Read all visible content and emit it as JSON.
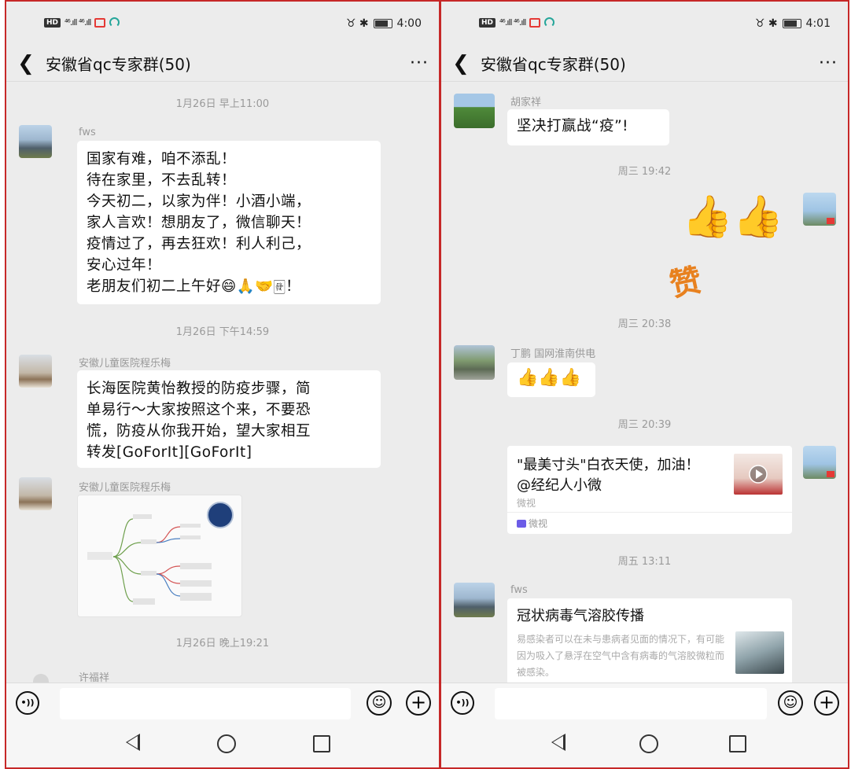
{
  "left": {
    "status": {
      "hd": "HD",
      "signal": "⁴⁶.ıll ⁴⁶.ıll",
      "right_icons": "♉ ✱",
      "time": "4:00"
    },
    "title": "安徽省qc专家群(50)",
    "timestamps": [
      "1月26日 早上11:00",
      "1月26日 下午14:59",
      "1月26日 晚上19:21"
    ],
    "messages": [
      {
        "sender": "fws",
        "lines": [
          "国家有难，咱不添乱！",
          "待在家里，不去乱转！",
          "今天初二，以家为伴！小酒小端，",
          "家人言欢！想朋友了，微信聊天！",
          "疫情过了，再去狂欢！利人利己，",
          "安心过年！",
          "老朋友们初二上午好😄🙏🤝🀅！"
        ]
      },
      {
        "sender": "安徽儿童医院程乐梅",
        "lines": [
          "长海医院黄怡教授的防疫步骤，简",
          "单易行～大家按照这个来，不要恐",
          "慌，防疫从你我开始，望大家相互",
          "转发[GoForIt][GoForIt]"
        ]
      },
      {
        "sender": "安徽儿童医院程乐梅",
        "image": "mindmap"
      },
      {
        "sender": "许福祥"
      }
    ]
  },
  "right": {
    "status": {
      "hd": "HD",
      "signal": "⁴⁶.ıll ⁴⁶.ıll",
      "right_icons": "♉ ✱",
      "time": "4:01"
    },
    "title": "安徽省qc专家群(50)",
    "messages": [
      {
        "sender": "胡家祥",
        "text": "坚决打赢战“疫”!"
      },
      {
        "time": "周三 19:42"
      },
      {
        "sticker_thumbs": "👍👍",
        "sticker_text": "赞"
      },
      {
        "time": "周三 20:38"
      },
      {
        "sender": "丁鹏 国网淮南供电",
        "text": "👍👍👍"
      },
      {
        "time": "周三 20:39"
      },
      {
        "card_title": "\"最美寸头\"白衣天使，加油！ @经纪人小微",
        "card_sub": "微视",
        "card_foot": "微视"
      },
      {
        "time": "周五 13:11"
      },
      {
        "sender": "fws",
        "card_title": "冠状病毒气溶胶传播",
        "card_desc": "易感染者可以在未与患病者见面的情况下，有可能因为吸入了悬浮在空气中含有病毒的气溶胶微粒而被感染。"
      }
    ]
  },
  "icons": {
    "back": "❮",
    "more": "···",
    "voice": "•))",
    "emoji": "☺",
    "plus": "+"
  },
  "colors": {
    "background": "#ececec",
    "bubble": "#ffffff",
    "border": "#c62828",
    "timestamp": "#9a9a9a"
  }
}
